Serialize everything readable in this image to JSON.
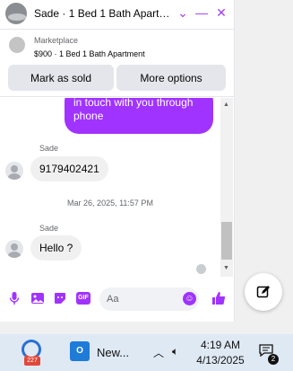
{
  "header": {
    "title": "Sade · 1 Bed 1 Bath Apart…",
    "icons": [
      "chevron-down-icon",
      "minimize-icon",
      "close-icon"
    ]
  },
  "marketplace": {
    "label": "Marketplace",
    "item": "$900 · 1 Bed 1 Bath Apartment",
    "mark_sold": "Mark as sold",
    "more_options": "More options"
  },
  "messages": {
    "outgoing_partial": "in touch with you through phone",
    "first": {
      "sender": "Sade",
      "text": "9179402421"
    },
    "timestamp": "Mar 26, 2025, 11:57 PM",
    "second": {
      "sender": "Sade",
      "text": "Hello ?"
    }
  },
  "composer": {
    "placeholder": "Aa",
    "icons": [
      "microphone-icon",
      "photo-icon",
      "sticker-icon",
      "gif-icon",
      "emoji-icon",
      "thumbs-up-icon"
    ],
    "gif_label": "GIF"
  },
  "taskbar": {
    "badge_count": "227",
    "app_label": "New...",
    "time": "4:19 AM",
    "date": "4/13/2025",
    "notification_count": "2"
  },
  "colors": {
    "accent": "#a033ff",
    "bubble_incoming": "#f0f0f0",
    "taskbar": "#dfe9f4"
  }
}
